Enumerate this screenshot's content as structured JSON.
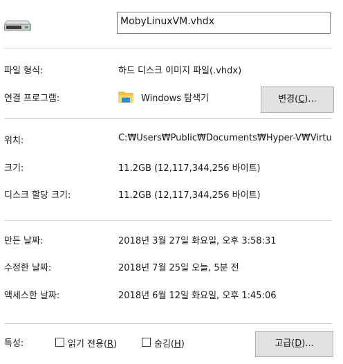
{
  "header": {
    "icon": "drive-icon",
    "filename": "MobyLinuxVM.vhdx"
  },
  "type": {
    "label": "파일 형식:",
    "value": "하드 디스크 이미지 파일(.vhdx)"
  },
  "opens_with": {
    "label": "연결 프로그램:",
    "icon": "folder-icon",
    "app": "Windows 탐색기",
    "change_pre": "변경(",
    "change_key": "C",
    "change_post": ")..."
  },
  "location": {
    "label": "위치:",
    "value": "C:₩Users₩Public₩Documents₩Hyper-V₩Virtu"
  },
  "size": {
    "label": "크기:",
    "value": "11.2GB (12,117,344,256 바이트)"
  },
  "size_on_disk": {
    "label": "디스크 할당 크기:",
    "value": "11.2GB (12,117,344,256 바이트)"
  },
  "created": {
    "label": "만든 날짜:",
    "value": "2018년 3월 27일 화요일, 오후 3:58:31"
  },
  "modified": {
    "label": "수정한 날짜:",
    "value": "2018년 7월 25일 오늘, 5분 전"
  },
  "accessed": {
    "label": "액세스한 날짜:",
    "value": "2018년 6월 12일 화요일, 오후 1:45:06"
  },
  "attributes": {
    "label": "특성:",
    "readonly_pre": "읽기 전용(",
    "readonly_key": "R",
    "readonly_post": ")",
    "readonly_checked": false,
    "hidden_pre": "숨김(",
    "hidden_key": "H",
    "hidden_post": ")",
    "hidden_checked": false,
    "advanced_pre": "고급(",
    "advanced_key": "D",
    "advanced_post": ")..."
  }
}
